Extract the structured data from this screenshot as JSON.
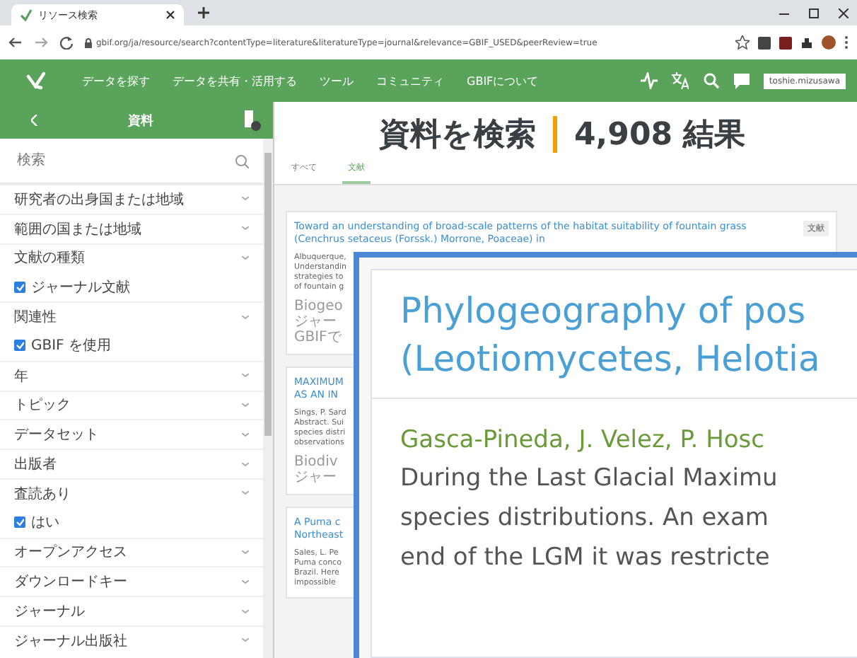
{
  "browser": {
    "tab_title": "リソース検索",
    "url": "gbif.org/ja/resource/search?contentType=literature&literatureType=journal&relevance=GBIF_USED&peerReview=true"
  },
  "nav": {
    "items": [
      "データを探す",
      "データを共有・活用する",
      "ツール",
      "コミュニティ",
      "GBIFについて"
    ],
    "login": "toshie.mizusawa"
  },
  "sidebar": {
    "title": "資料",
    "search": {
      "placeholder": "検索"
    },
    "filters": [
      {
        "kind": "facet",
        "label": "研究者の出身国または地域"
      },
      {
        "kind": "facet",
        "label": "範囲の国または地域"
      },
      {
        "kind": "facet",
        "label": "文献の種類"
      },
      {
        "kind": "option",
        "label": "ジャーナル文献",
        "checked": true
      },
      {
        "kind": "facet",
        "label": "関連性"
      },
      {
        "kind": "option",
        "label": "GBIF を使用",
        "checked": true
      },
      {
        "kind": "facet",
        "label": "年"
      },
      {
        "kind": "facet",
        "label": "トピック"
      },
      {
        "kind": "facet",
        "label": "データセット"
      },
      {
        "kind": "facet",
        "label": "出版者"
      },
      {
        "kind": "facet",
        "label": "査読あり"
      },
      {
        "kind": "option",
        "label": "はい",
        "checked": true
      },
      {
        "kind": "facet",
        "label": "オープンアクセス"
      },
      {
        "kind": "facet",
        "label": "ダウンロードキー"
      },
      {
        "kind": "facet",
        "label": "ジャーナル"
      },
      {
        "kind": "facet",
        "label": "ジャーナル出版社"
      }
    ]
  },
  "results": {
    "heading": "資料を検索",
    "count": "4,908 結果",
    "tabs": [
      {
        "label": "すべて",
        "selected": false
      },
      {
        "label": "文献",
        "selected": true
      }
    ],
    "cards": [
      {
        "title_lines": [
          "Toward an understanding of broad-scale patterns of the habitat suitability of fountain grass",
          "(Cenchrus setaceus (Forssk.) Morrone, Poaceae) in"
        ],
        "tag": "文献",
        "lines": [
          "Albuquerque,",
          "Understandin",
          "strategies to",
          "of fountain g"
        ],
        "meta": [
          "Biogeo",
          "ジャー",
          "GBIFで"
        ]
      },
      {
        "title_lines": [
          "MAXIMUM",
          "AS AN IN"
        ],
        "lines": [
          "Sings, P. Sard",
          "Abstract. Sui",
          "species distri",
          "observations"
        ],
        "meta": [
          "Biodiv",
          "ジャー"
        ]
      },
      {
        "title_lines": [
          "A Puma c",
          "Northeast"
        ],
        "lines": [
          "Sales, L. Pe",
          "Puma conco",
          "Brazil. Here",
          "impossible"
        ]
      }
    ]
  },
  "inset": {
    "title_lines": [
      "Phylogeography of pos",
      "(Leotiomycetes, Helotia"
    ],
    "authors": "Gasca-Pineda, J. Velez, P. Hosc",
    "abstract_lines": [
      "During the Last Glacial Maximu",
      "species distributions. An exam",
      "end of the LGM it was restricte"
    ]
  }
}
